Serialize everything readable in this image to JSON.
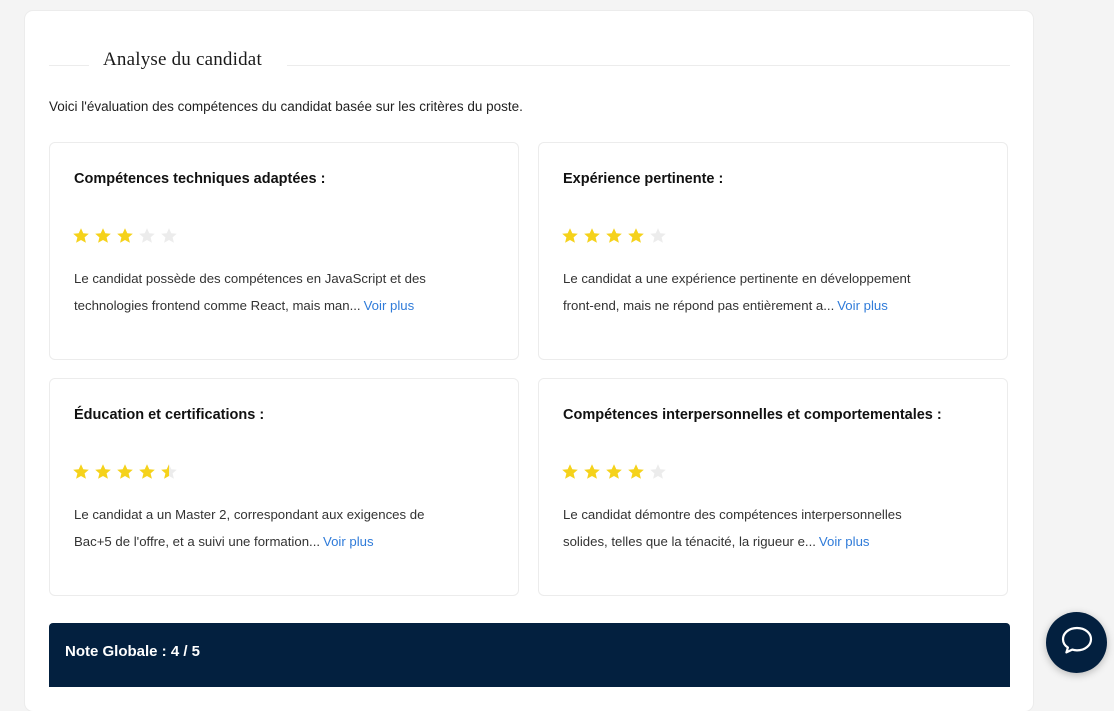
{
  "section": {
    "title": "Analyse du candidat",
    "intro": "Voici l'évaluation des compétences du candidat basée sur les critères du poste."
  },
  "cards": [
    {
      "title": "Compétences techniques adaptées :",
      "rating": 3,
      "text": "Le candidat possède des compétences en JavaScript et des technologies frontend comme React, mais man...",
      "more": "Voir plus"
    },
    {
      "title": "Expérience pertinente :",
      "rating": 4,
      "text": "Le candidat a une expérience pertinente en développement front-end, mais ne répond pas entièrement a...",
      "more": "Voir plus"
    },
    {
      "title": "Éducation et certifications :",
      "rating": 4.5,
      "text": "Le candidat a un Master 2, correspondant aux exigences de Bac+5 de l'offre, et a suivi une formation...",
      "more": "Voir plus"
    },
    {
      "title": "Compétences interpersonnelles et comportementales :",
      "rating": 4,
      "text": "Le candidat démontre des compétences interpersonnelles solides, telles que la ténacité, la rigueur e...",
      "more": "Voir plus"
    }
  ],
  "global": {
    "label": "Note Globale : 4 / 5"
  },
  "colors": {
    "star_filled": "#f5d21b",
    "star_empty": "#ececec",
    "link": "#2f7bd9",
    "navy": "#03203f"
  },
  "icons": {
    "star": "star-icon",
    "chat": "chat-bubble-icon"
  }
}
